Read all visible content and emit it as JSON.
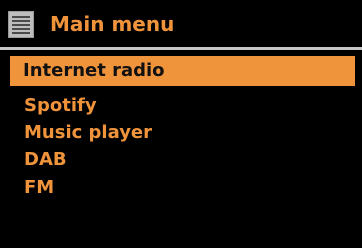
{
  "header": {
    "icon": "menu-list-icon",
    "title": "Main menu"
  },
  "colors": {
    "accent": "#f0943c",
    "background": "#000000",
    "selected_text": "#111111",
    "divider": "#c7c7c7"
  },
  "menu": {
    "items": [
      {
        "label": "Internet radio",
        "selected": true
      },
      {
        "label": "Spotify",
        "selected": false
      },
      {
        "label": "Music player",
        "selected": false
      },
      {
        "label": "DAB",
        "selected": false
      },
      {
        "label": "FM",
        "selected": false
      }
    ]
  }
}
